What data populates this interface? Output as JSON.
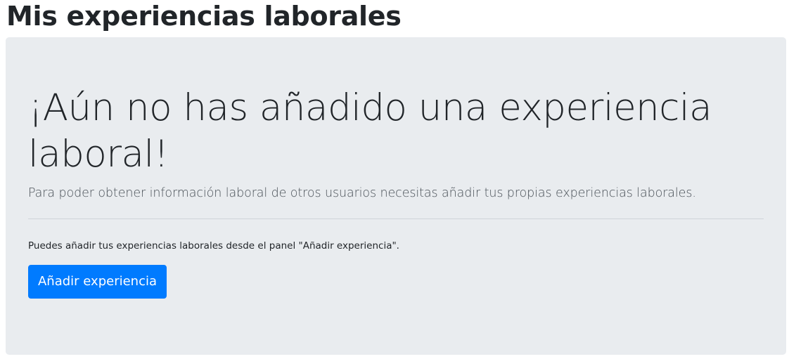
{
  "page": {
    "title": "Mis experiencias laborales"
  },
  "empty_state": {
    "heading": "¡Aún no has añadido una experiencia laboral!",
    "lead": "Para poder obtener información laboral de otros usuarios necesitas añadir tus propias experiencias laborales.",
    "hint": "Puedes añadir tus experiencias laborales desde el panel \"Añadir experiencia\".",
    "button_label": "Añadir experiencia"
  },
  "colors": {
    "panel_background": "#e9ecef",
    "primary_button": "#007bff",
    "text": "#212529"
  }
}
